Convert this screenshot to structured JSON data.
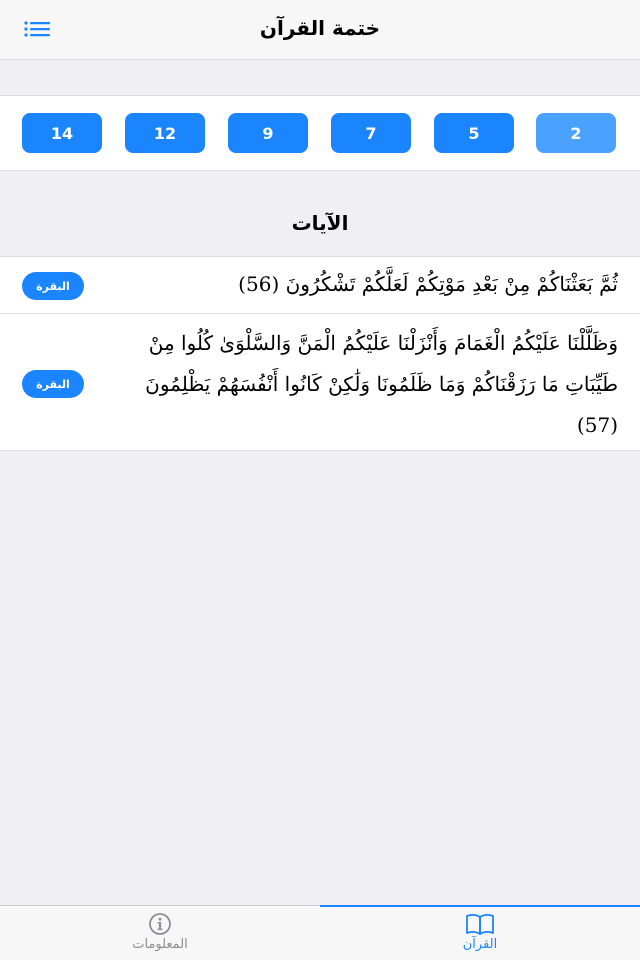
{
  "nav": {
    "title": "ختمة القرآن",
    "menu_icon": "list-menu-icon"
  },
  "chips": [
    {
      "label": "14",
      "selected": false
    },
    {
      "label": "12",
      "selected": false
    },
    {
      "label": "9",
      "selected": false
    },
    {
      "label": "7",
      "selected": false
    },
    {
      "label": "5",
      "selected": false
    },
    {
      "label": "2",
      "selected": true
    }
  ],
  "section": {
    "title": "الآيات"
  },
  "verses": [
    {
      "text": "ثُمَّ بَعَثْنَاكُمْ مِنْ بَعْدِ مَوْتِكُمْ لَعَلَّكُمْ تَشْكُرُونَ (56)",
      "surah": "البقرة"
    },
    {
      "text": "وَظَلَّلْنَا عَلَيْكُمُ الْغَمَامَ وَأَنْزَلْنَا عَلَيْكُمُ الْمَنَّ وَالسَّلْوَىٰ كُلُوا مِنْ طَيِّبَاتِ مَا رَزَقْنَاكُمْ وَمَا ظَلَمُونَا وَلَٰكِنْ كَانُوا أَنْفُسَهُمْ يَظْلِمُونَ (57)",
      "surah": "البقرة"
    }
  ],
  "tabs": {
    "info": {
      "label": "المعلومات",
      "icon": "info-circle-icon"
    },
    "quran": {
      "label": "القرآن",
      "icon": "open-book-icon",
      "active": true
    }
  },
  "colors": {
    "accent": "#1a85ff",
    "accent_selected": "#4aa1ff",
    "background": "#efeff4",
    "inactive_tab": "#8e8e93"
  }
}
